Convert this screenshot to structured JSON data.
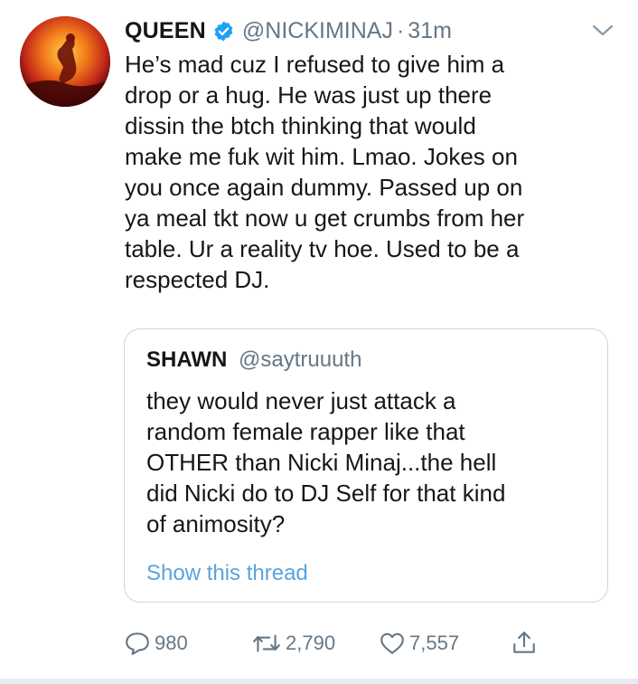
{
  "tweet": {
    "display_name": "QUEEN",
    "handle": "@NICKIMINAJ",
    "separator": "·",
    "time": "31m",
    "text_lines": [
      "He’s mad cuz I refused to give him a",
      "drop or a hug. He was just up there",
      "dissin the btch thinking that would",
      "make me fuk wit him. Lmao. Jokes on",
      "you once again dummy. Passed up on",
      "ya meal tkt now u get crumbs from her",
      "table. Ur a reality tv hoe. Used to be a",
      "respected DJ."
    ]
  },
  "quote": {
    "display_name": "SHAWN",
    "handle": "@saytruuuth",
    "text_lines": [
      "they would never just attack a",
      "random female rapper like that",
      "OTHER than Nicki Minaj...the hell",
      "did Nicki do to DJ Self for that kind",
      "of animosity?"
    ],
    "show_thread": "Show this thread"
  },
  "actions": {
    "replies": "980",
    "retweets": "2,790",
    "likes": "7,557"
  },
  "colors": {
    "text": "#14171a",
    "secondary": "#657786",
    "link": "#1da1f2",
    "verified": "#1da1f2",
    "border": "#ccd6dd"
  },
  "icons": {
    "verified": "verified-badge-icon",
    "caret": "chevron-down-icon",
    "reply": "reply-icon",
    "retweet": "retweet-icon",
    "like": "heart-icon",
    "share": "share-icon"
  }
}
